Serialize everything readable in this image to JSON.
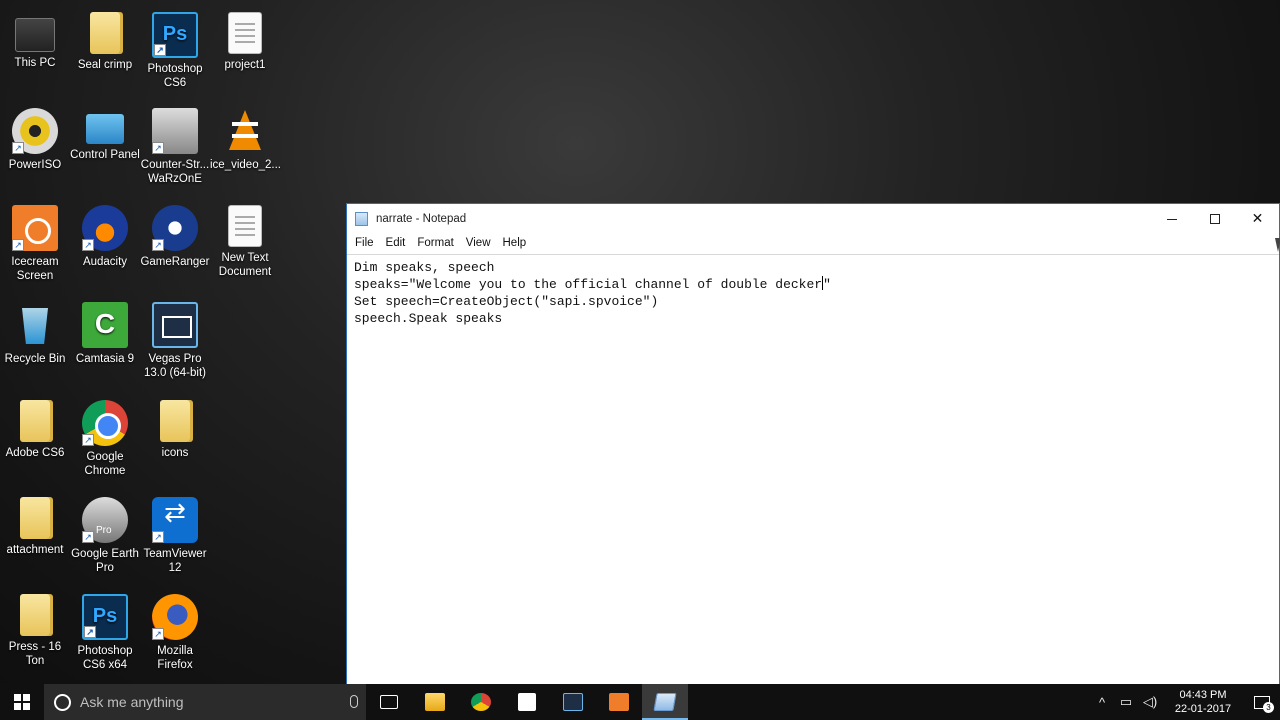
{
  "desktop": {
    "icons": [
      {
        "label": "This PC"
      },
      {
        "label": "Seal crimp"
      },
      {
        "label": "Photoshop CS6"
      },
      {
        "label": "project1"
      },
      {
        "label": "PowerISO"
      },
      {
        "label": "Control Panel"
      },
      {
        "label": "Counter-Str... WaRzOnE"
      },
      {
        "label": "ice_video_2..."
      },
      {
        "label": "Icecream Screen"
      },
      {
        "label": "Audacity"
      },
      {
        "label": "GameRanger"
      },
      {
        "label": "New Text Document"
      },
      {
        "label": "Recycle Bin"
      },
      {
        "label": "Camtasia 9"
      },
      {
        "label": "Vegas Pro 13.0 (64-bit)"
      },
      {
        "label": "Adobe CS6"
      },
      {
        "label": "Google Chrome"
      },
      {
        "label": "icons"
      },
      {
        "label": "attachment"
      },
      {
        "label": "Google Earth Pro"
      },
      {
        "label": "TeamViewer 12"
      },
      {
        "label": "Press - 16 Ton"
      },
      {
        "label": "Photoshop CS6 x64"
      },
      {
        "label": "Mozilla Firefox"
      }
    ]
  },
  "notepad": {
    "title": "narrate - Notepad",
    "menu": [
      "File",
      "Edit",
      "Format",
      "View",
      "Help"
    ],
    "lines": [
      "Dim speaks, speech",
      "speaks=\"Welcome you to the official channel of double decker",
      "Set speech=CreateObject(\"sapi.spvoice\")",
      "speech.Speak speaks"
    ],
    "line2_tail": "\"",
    "controls": {
      "minimize": "minimize",
      "maximize": "maximize",
      "close": "✕"
    }
  },
  "taskbar": {
    "search_placeholder": "Ask me anything",
    "clock_time": "04:43 PM",
    "clock_date": "22-01-2017",
    "notification_count": "3"
  }
}
